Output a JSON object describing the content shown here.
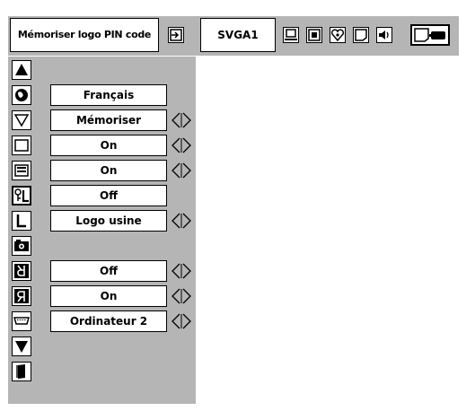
{
  "toolbar": {
    "title": "Mémoriser logo PIN code",
    "mode": "SVGA1",
    "icons": [
      "input-icon",
      "pc-adjust-icon",
      "image-select-icon",
      "image-adjust-icon",
      "screen-icon",
      "sound-icon",
      "setting-icon"
    ]
  },
  "menu": {
    "up_arrow": "up-arrow-icon",
    "down_arrow": "down-arrow-icon",
    "exit": "exit-icon",
    "items": [
      {
        "icon": "language-icon",
        "value": "Français",
        "has_adjust": false
      },
      {
        "icon": "blue-back-icon",
        "value": "Mémoriser",
        "has_adjust": true
      },
      {
        "icon": "display-icon",
        "value": "On",
        "has_adjust": true
      },
      {
        "icon": "logo-icon",
        "value": "On",
        "has_adjust": true
      },
      {
        "icon": "logo-pin-lock-icon",
        "value": "Off",
        "has_adjust": false
      },
      {
        "icon": "logo-select-icon",
        "value": "Logo usine",
        "has_adjust": true
      },
      {
        "icon": "capture-icon",
        "value": "",
        "has_adjust": false
      },
      {
        "icon": "ceiling-icon",
        "value": "Off",
        "has_adjust": true
      },
      {
        "icon": "rear-icon",
        "value": "On",
        "has_adjust": true
      },
      {
        "icon": "terminal-icon",
        "value": "Ordinateur 2",
        "has_adjust": true
      }
    ]
  }
}
